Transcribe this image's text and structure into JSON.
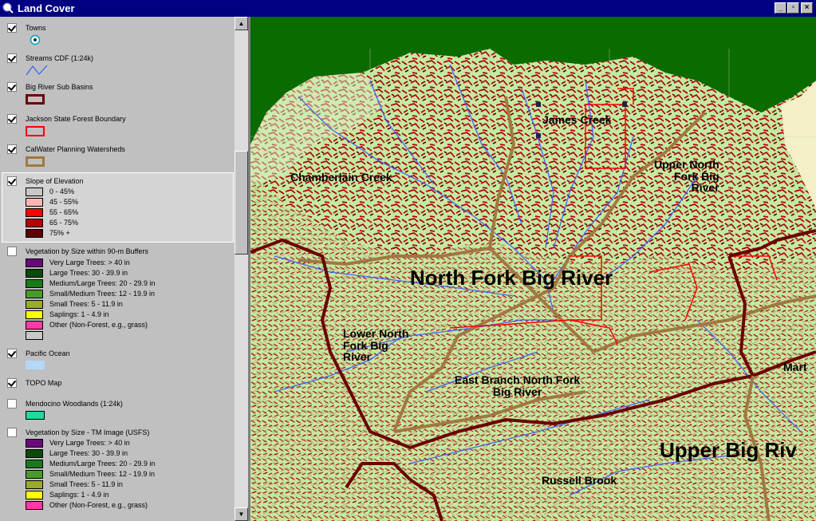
{
  "window": {
    "title": "Land Cover",
    "min_label": "_",
    "max_label": "▫",
    "close_label": "×"
  },
  "toc": {
    "layers": [
      {
        "name": "Towns",
        "checked": true
      },
      {
        "name": "Streams CDF (1:24k)",
        "checked": true
      },
      {
        "name": "Big River Sub Basins",
        "checked": true
      },
      {
        "name": "Jackson State Forest Boundary",
        "checked": true
      },
      {
        "name": "CalWater Planning Watersheds",
        "checked": true
      },
      {
        "name": "Slope of Elevation",
        "checked": true,
        "legend": [
          {
            "label": "0 - 45%",
            "color": "#c8c8c8"
          },
          {
            "label": "45 - 55%",
            "color": "#ffb4b4"
          },
          {
            "label": "55 - 65%",
            "color": "#ff0000"
          },
          {
            "label": "65 - 75%",
            "color": "#b40000"
          },
          {
            "label": "75% +",
            "color": "#5a0000"
          }
        ]
      },
      {
        "name": "Vegetation by Size within 90-m Buffers",
        "checked": false,
        "legend": [
          {
            "label": "Very Large Trees: > 40  in",
            "color": "#6a0a7a"
          },
          {
            "label": "Large Trees: 30 - 39.9 in",
            "color": "#0a4a0a"
          },
          {
            "label": "Medium/Large Trees: 20 - 29.9 in",
            "color": "#1a7a1a"
          },
          {
            "label": "Small/Medium Trees: 12 - 19.9 in",
            "color": "#4a9a2a"
          },
          {
            "label": "Small Trees: 5 - 11.9 in",
            "color": "#9aaa2a"
          },
          {
            "label": "Saplings: 1 - 4.9 in",
            "color": "#ffff00"
          },
          {
            "label": "Other (Non-Forest, e.g., grass)",
            "color": "#ff3aa8"
          },
          {
            "label": "",
            "color": "#c8c8c8"
          }
        ]
      },
      {
        "name": "Pacific Ocean",
        "checked": true
      },
      {
        "name": "TOPO Map",
        "checked": true
      },
      {
        "name": "Mendocino Woodlands (1:24k)",
        "checked": false
      },
      {
        "name": "Vegetation by Size - TM Image (USFS)",
        "checked": false,
        "legend": [
          {
            "label": "Very Large Trees: > 40  in",
            "color": "#6a0a7a"
          },
          {
            "label": "Large Trees: 30 - 39.9 in",
            "color": "#0a4a0a"
          },
          {
            "label": "Medium/Large Trees: 20 - 29.9 in",
            "color": "#1a7a1a"
          },
          {
            "label": "Small/Medium Trees: 12 - 19.9 in",
            "color": "#4a9a2a"
          },
          {
            "label": "Small Trees: 5 - 11.9 in",
            "color": "#9aaa2a"
          },
          {
            "label": "Saplings: 1 - 4.9 in",
            "color": "#ffff00"
          },
          {
            "label": "Other (Non-Forest, e.g., grass)",
            "color": "#ff3aa8"
          }
        ]
      }
    ]
  },
  "symbols": {
    "towns_color": "#00a0c0",
    "streams_color": "#3060ff",
    "subbasin_color": "#6a0000",
    "forest_boundary_color": "#ff0000",
    "watershed_color": "#a07840",
    "ocean_color": "#b4d8f8",
    "woodlands_color": "#20d8a0"
  },
  "map": {
    "labels": {
      "chamberlain": "Chamberlain Creek",
      "james": "James Creek",
      "upper_north_fork": "Upper North\nFork Big\nRiver",
      "north_fork": "North Fork Big River",
      "lower_north_fork": "Lower North\nFork Big\nRiver",
      "east_branch": "East Branch North Fork\nBig River",
      "upper_big": "Upper Big Riv",
      "russell": "Russell Brook",
      "mart": "Mart"
    },
    "colors": {
      "land": "#c4eaa0",
      "ocean": "#0a6b00",
      "slope_high": "#a00010",
      "slope_max": "#5a0000",
      "river": "#3858ff",
      "subbasin": "#6a0000",
      "watershed": "#a07840",
      "forest": "#ff0000",
      "east": "#f4f0c8"
    }
  }
}
